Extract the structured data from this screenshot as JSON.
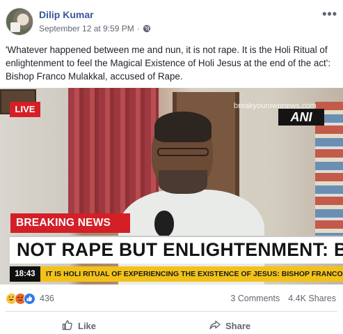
{
  "post": {
    "author": "Dilip Kumar",
    "timestamp": "September 12 at 9:59 PM",
    "separator": "·",
    "audience_icon": "globe-icon",
    "more_icon": "more-options-icon",
    "more_label": "•••",
    "caption": "'Whatever happened between me and nun, it is not rape. It is the Holi Ritual of enlightenment to feel the Magical Existence of Holi Jesus at the end of the act': Bishop Franco Mulakkal, accused of Rape."
  },
  "media": {
    "live_label": "LIVE",
    "watermark": "breakyourownnews.com",
    "channel_logo": "ANI",
    "breaking_label": "BREAKING NEWS",
    "headline": "NOT RAPE BUT ENLIGHTENMENT: BI",
    "ticker_time": "18:43",
    "ticker_text": "IT IS HOLI RITUAL OF EXPERIENCING THE EXISTENCE OF JESUS: BISHOP FRANCO MU",
    "colors": {
      "live_red": "#d51f26",
      "ticker_yellow": "#f2c21a"
    }
  },
  "engagement": {
    "reaction_icons": [
      "haha-reaction-icon",
      "angry-reaction-icon",
      "like-reaction-icon"
    ],
    "reaction_count": "436",
    "comments": "3 Comments",
    "shares": "4.4K Shares"
  },
  "actions": {
    "like_label": "Like",
    "share_label": "Share"
  },
  "colors": {
    "author_blue": "#385898",
    "muted_text": "#606770"
  }
}
